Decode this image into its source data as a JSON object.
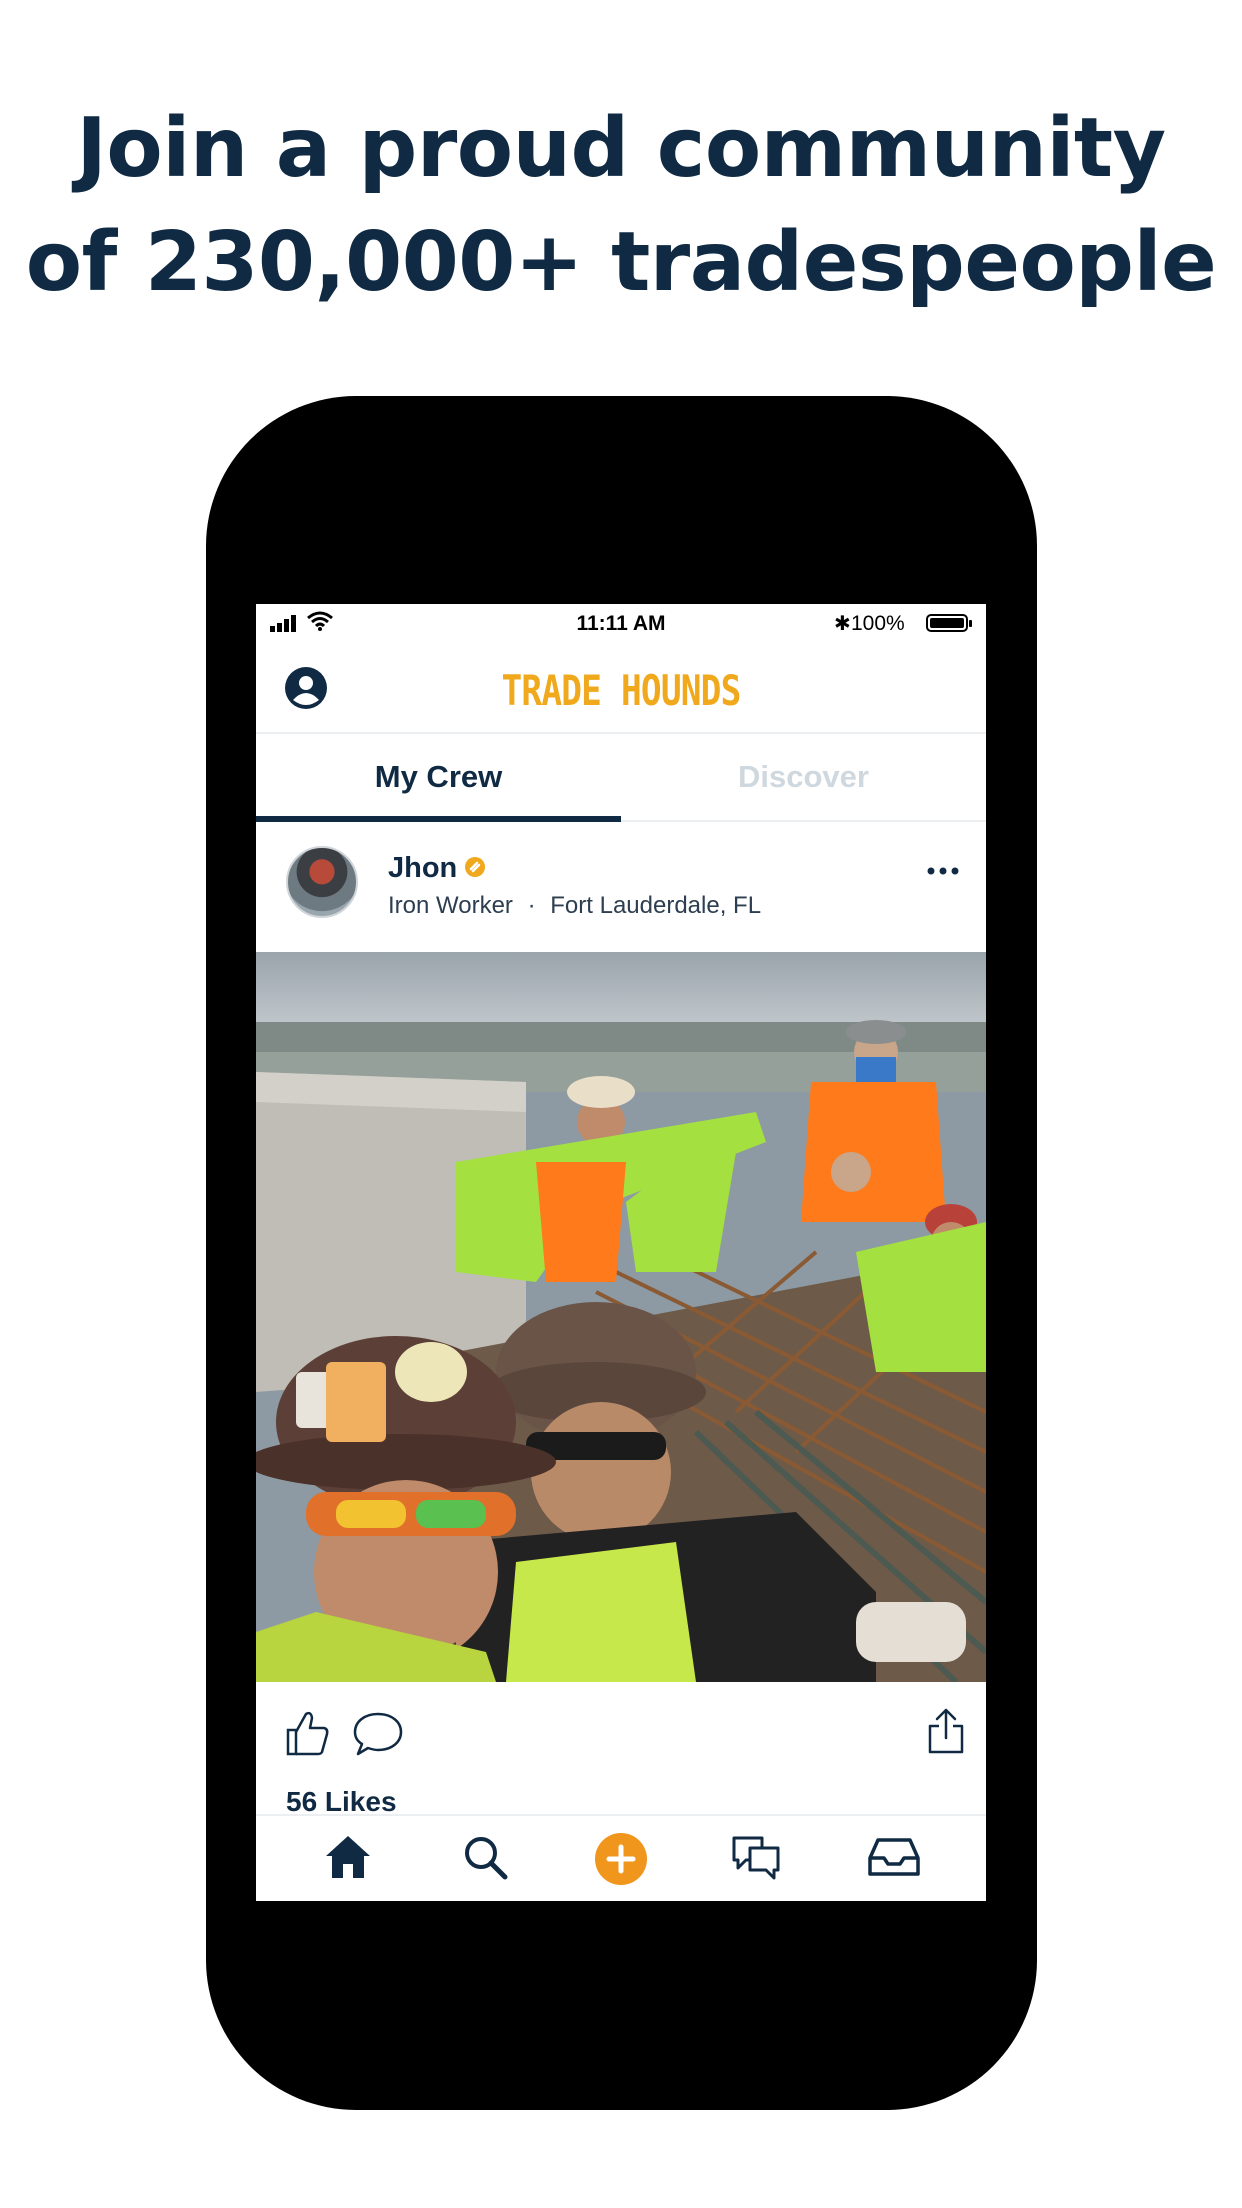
{
  "headline": {
    "line1": "Join a proud community",
    "line2": "of 230,000+ tradespeople"
  },
  "statusbar": {
    "time": "11:11 AM",
    "bluetooth": "✱",
    "battery": "100%"
  },
  "app": {
    "logo": "TRADE HOUNDS",
    "profile_icon": "user-circle-icon"
  },
  "tabs": [
    {
      "label": "My Crew",
      "active": true
    },
    {
      "label": "Discover",
      "active": false
    }
  ],
  "post": {
    "author": "Jhon",
    "verified": true,
    "trade": "Iron Worker",
    "separator": "·",
    "location": "Fort Lauderdale, FL",
    "photo": "group-selfie-ironworkers-on-rebar-deck",
    "likes": "56 Likes"
  },
  "bottom_nav": [
    {
      "name": "home",
      "icon": "home-icon"
    },
    {
      "name": "search",
      "icon": "search-icon"
    },
    {
      "name": "create",
      "icon": "plus-circle-icon"
    },
    {
      "name": "messages",
      "icon": "chat-icon"
    },
    {
      "name": "inbox",
      "icon": "inbox-icon"
    }
  ],
  "colors": {
    "navy": "#102a43",
    "accent": "#f0a81c",
    "inactive": "#cfd8df"
  }
}
